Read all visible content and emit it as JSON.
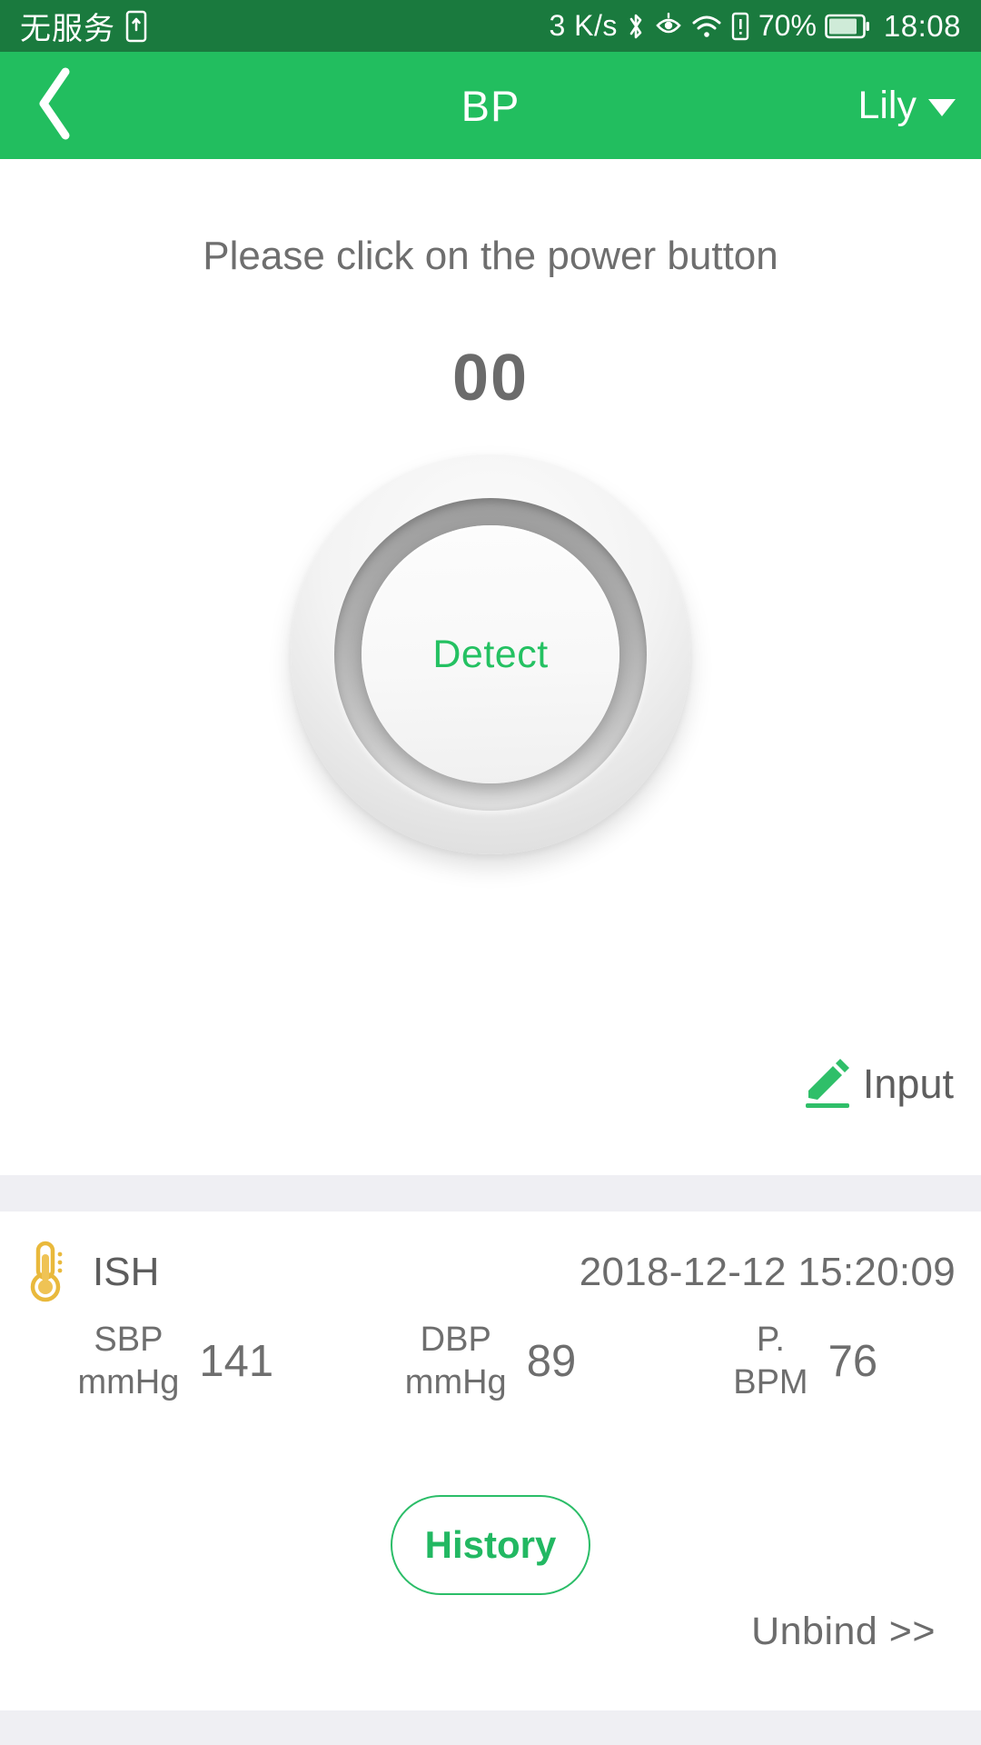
{
  "status_bar": {
    "carrier": "无服务",
    "sim_icon": "sim-card-icon",
    "network_speed": "3 K/s",
    "bluetooth_icon": "bluetooth-icon",
    "eye_icon": "eye-care-icon",
    "wifi_icon": "wifi-icon",
    "sim_alert_icon": "sim-alert-icon",
    "battery_percent": "70%",
    "battery_icon": "battery-icon",
    "time": "18:08",
    "background_color": "#1A7A3E",
    "text_color": "#FFFFFF"
  },
  "app_bar": {
    "back_icon": "chevron-left-icon",
    "title": "BP",
    "user_name": "Lily",
    "dropdown_icon": "caret-down-icon",
    "background_color": "#22BE5F"
  },
  "measure_panel": {
    "hint": "Please click on the power button",
    "counter": "00",
    "power_button_label": "Detect",
    "power_button_accent": "#24C162",
    "input_icon": "pencil-icon",
    "input_label": "Input"
  },
  "result": {
    "category_icon": "thermometer-icon",
    "category_icon_color": "#E9B93C",
    "category_label": "ISH",
    "timestamp": "2018-12-12 15:20:09",
    "metrics": [
      {
        "label": "SBP\nmmHg",
        "value": "141"
      },
      {
        "label": "DBP\nmmHg",
        "value": "89"
      },
      {
        "label": "P.\nBPM",
        "value": "76"
      }
    ],
    "history_label": "History",
    "history_accent": "#22B862",
    "unbind_label": "Unbind >>"
  }
}
